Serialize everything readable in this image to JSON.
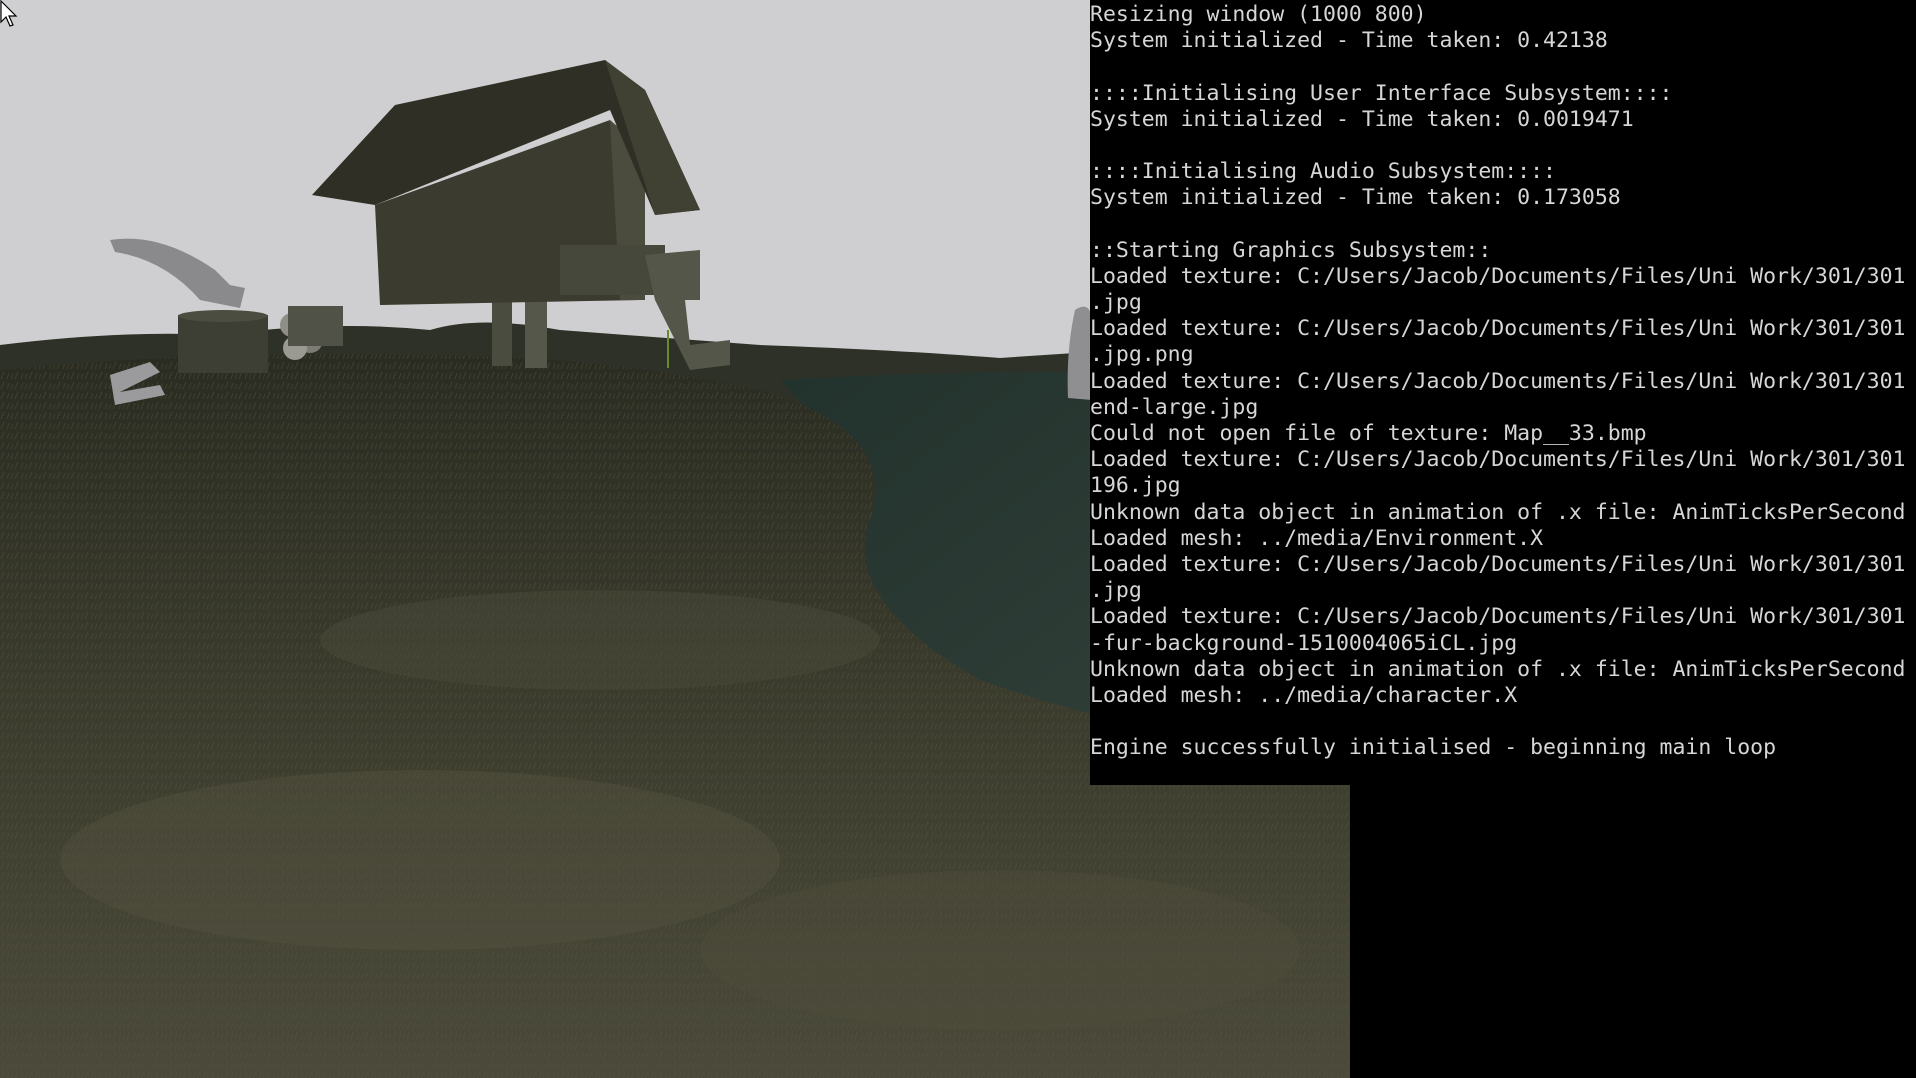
{
  "app": {
    "viewport_label": "3D scene view",
    "console_lines": [
      "Resizing window (1000 800)",
      "System initialized - Time taken: 0.42138",
      "",
      "::::Initialising User Interface Subsystem::::",
      "System initialized - Time taken: 0.0019471",
      "",
      "::::Initialising Audio Subsystem::::",
      "System initialized - Time taken: 0.173058",
      "",
      "::Starting Graphics Subsystem::",
      "Loaded texture: C:/Users/Jacob/Documents/Files/Uni Work/301/301",
      ".jpg",
      "Loaded texture: C:/Users/Jacob/Documents/Files/Uni Work/301/301",
      ".jpg.png",
      "Loaded texture: C:/Users/Jacob/Documents/Files/Uni Work/301/301",
      "end-large.jpg",
      "Could not open file of texture: Map__33.bmp",
      "Loaded texture: C:/Users/Jacob/Documents/Files/Uni Work/301/301",
      "196.jpg",
      "Unknown data object in animation of .x file: AnimTicksPerSecond",
      "Loaded mesh: ../media/Environment.X",
      "Loaded texture: C:/Users/Jacob/Documents/Files/Uni Work/301/301",
      ".jpg",
      "Loaded texture: C:/Users/Jacob/Documents/Files/Uni Work/301/301",
      "-fur-background-1510004065iCL.jpg",
      "Unknown data object in animation of .x file: AnimTicksPerSecond",
      "Loaded mesh: ../media/character.X",
      "",
      "Engine successfully initialised - beginning main loop"
    ]
  },
  "colors": {
    "sky": "#cfcfd1",
    "grass_dark": "#2f3122",
    "grass_light": "#4a4a38",
    "water": "#2c3a33",
    "house": "#3a3a2e",
    "console_bg": "#000000",
    "console_text": "#d6d6d6"
  },
  "icons": {
    "cursor": "mouse-pointer-icon"
  }
}
